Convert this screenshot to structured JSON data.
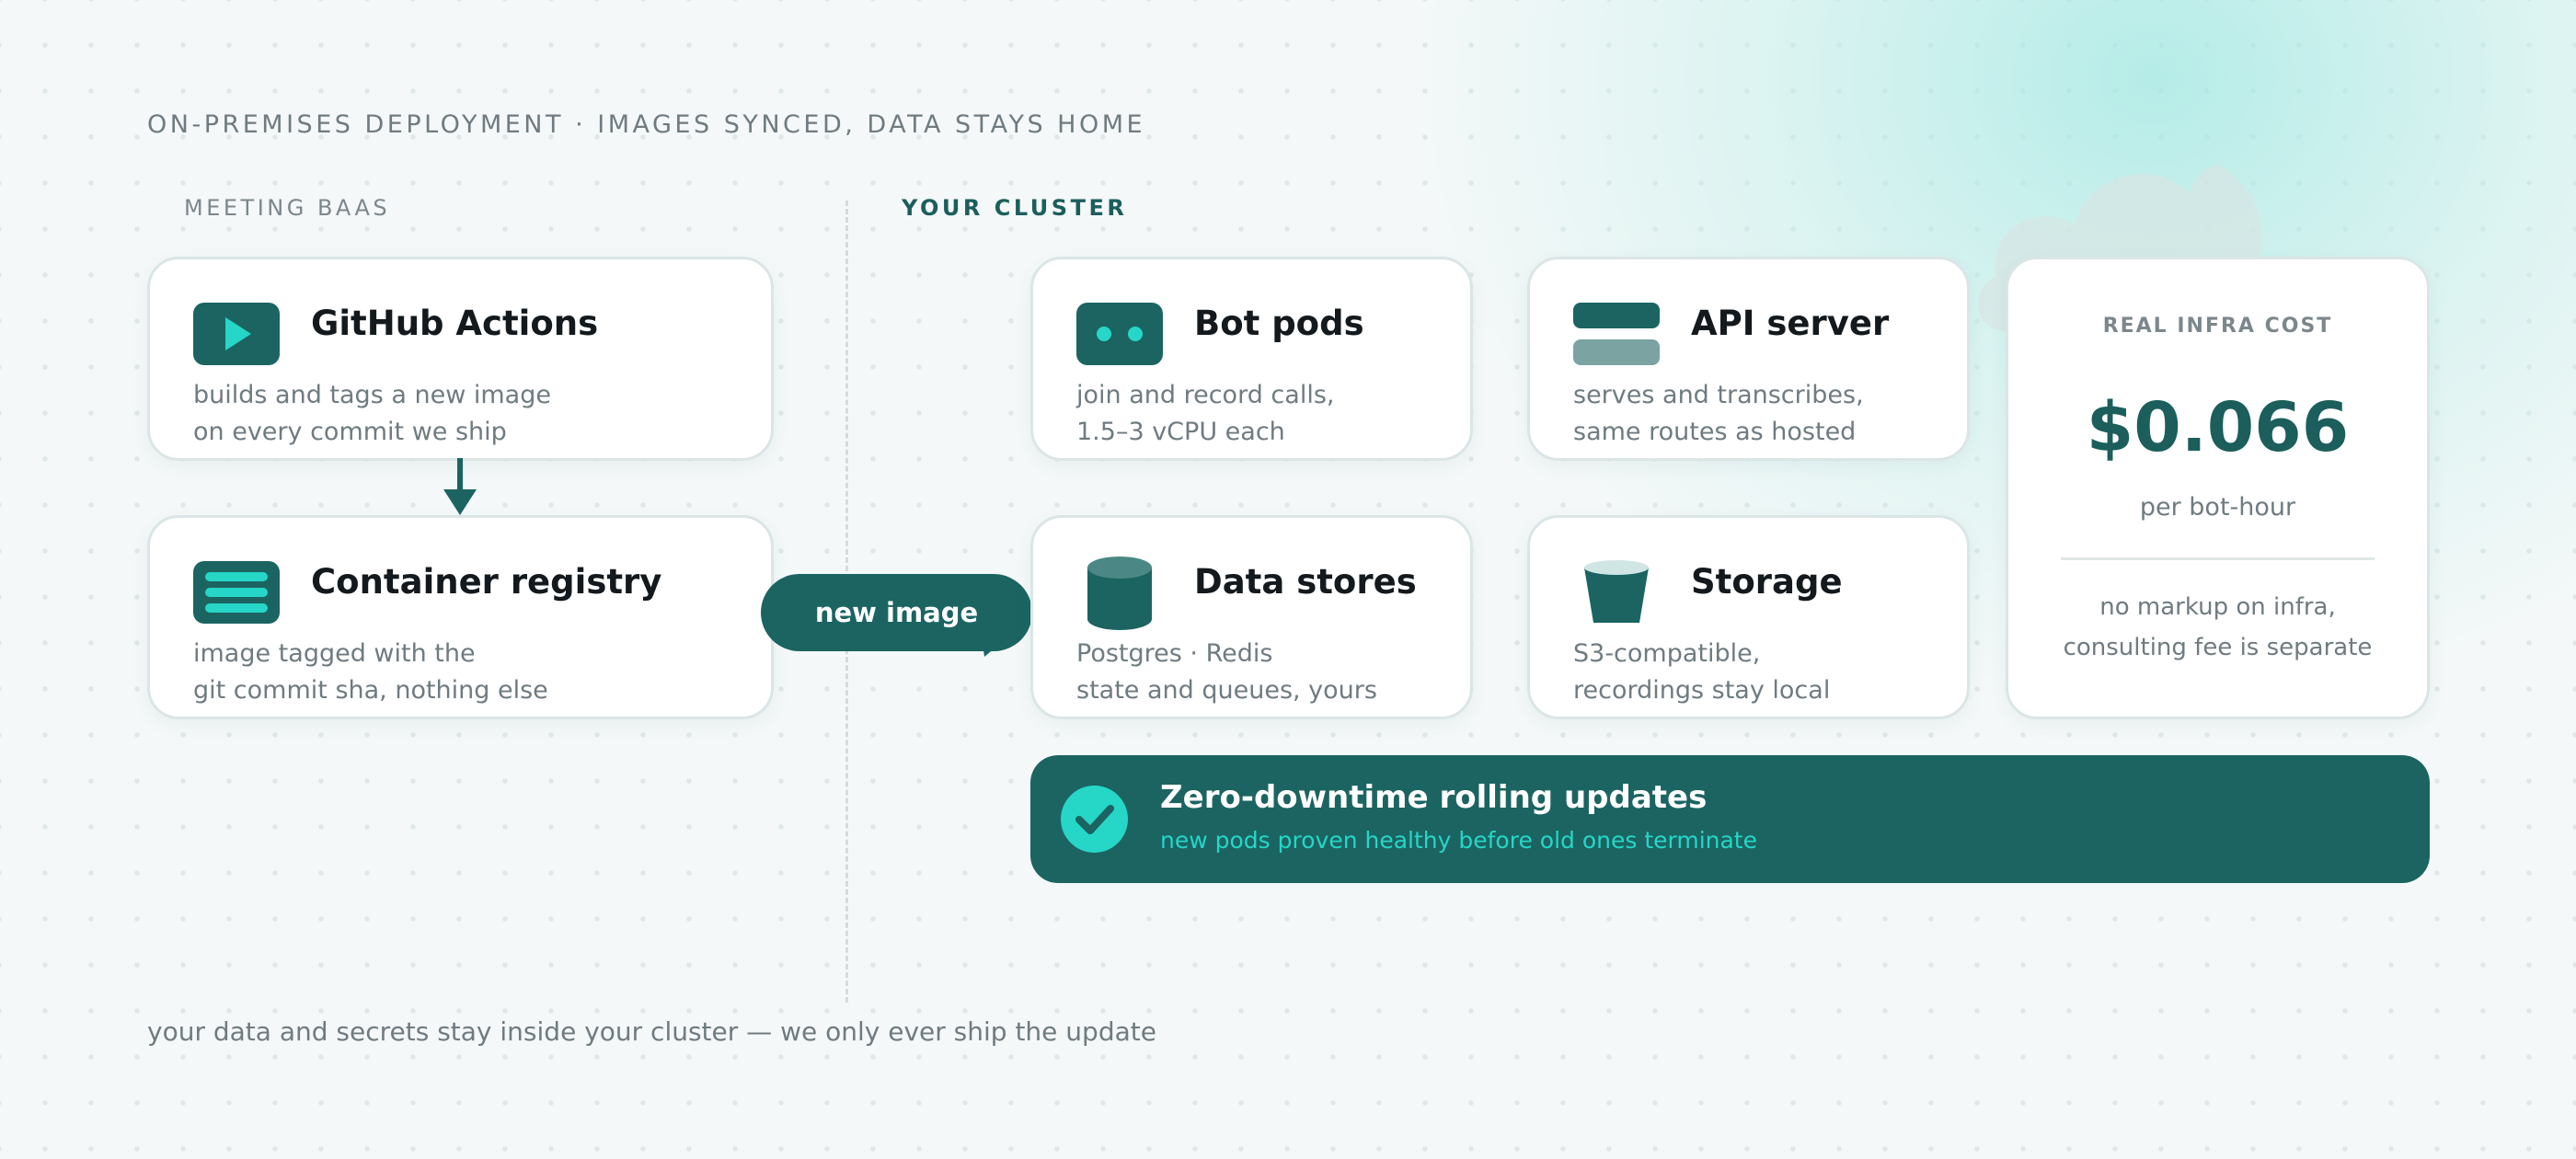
{
  "headline": "ON-PREMISES DEPLOYMENT · IMAGES SYNCED, DATA STAYS HOME",
  "sections": {
    "left": "MEETING BAAS",
    "right": "YOUR CLUSTER"
  },
  "cards": {
    "github": {
      "title": "GitHub Actions",
      "desc1": "builds and tags a new image",
      "desc2": "on every commit we ship",
      "icon": "play-icon"
    },
    "registry": {
      "title": "Container registry",
      "desc1": "image tagged with the",
      "desc2": "git commit sha, nothing else",
      "icon": "registry-icon"
    },
    "bots": {
      "title": "Bot pods",
      "desc1": "join and record calls,",
      "desc2": "1.5–3 vCPU each",
      "icon": "bot-icon"
    },
    "api": {
      "title": "API server",
      "desc1": "serves and transcribes,",
      "desc2": "same routes as hosted",
      "icon": "server-icon"
    },
    "data": {
      "title": "Data stores",
      "desc1": "Postgres · Redis",
      "desc2": "state and queues, yours",
      "icon": "database-icon"
    },
    "storage": {
      "title": "Storage",
      "desc1": "S3-compatible,",
      "desc2": "recordings stay local",
      "icon": "bucket-icon"
    }
  },
  "cost": {
    "label": "REAL INFRA COST",
    "value": "$0.066",
    "unit": "per bot-hour",
    "note1": "no markup on infra,",
    "note2": "consulting fee is separate"
  },
  "flow": {
    "pill": "new image"
  },
  "banner": {
    "title": "Zero-downtime rolling updates",
    "subtitle": "new pods proven healthy before old ones terminate"
  },
  "footer": "your data and secrets stay inside your cluster — we only ever ship the update",
  "colors": {
    "teal_dark": "#1b6462",
    "teal_accent": "#26d6c7",
    "text_muted": "#6f7b80",
    "card_border": "#dbe5e5"
  }
}
